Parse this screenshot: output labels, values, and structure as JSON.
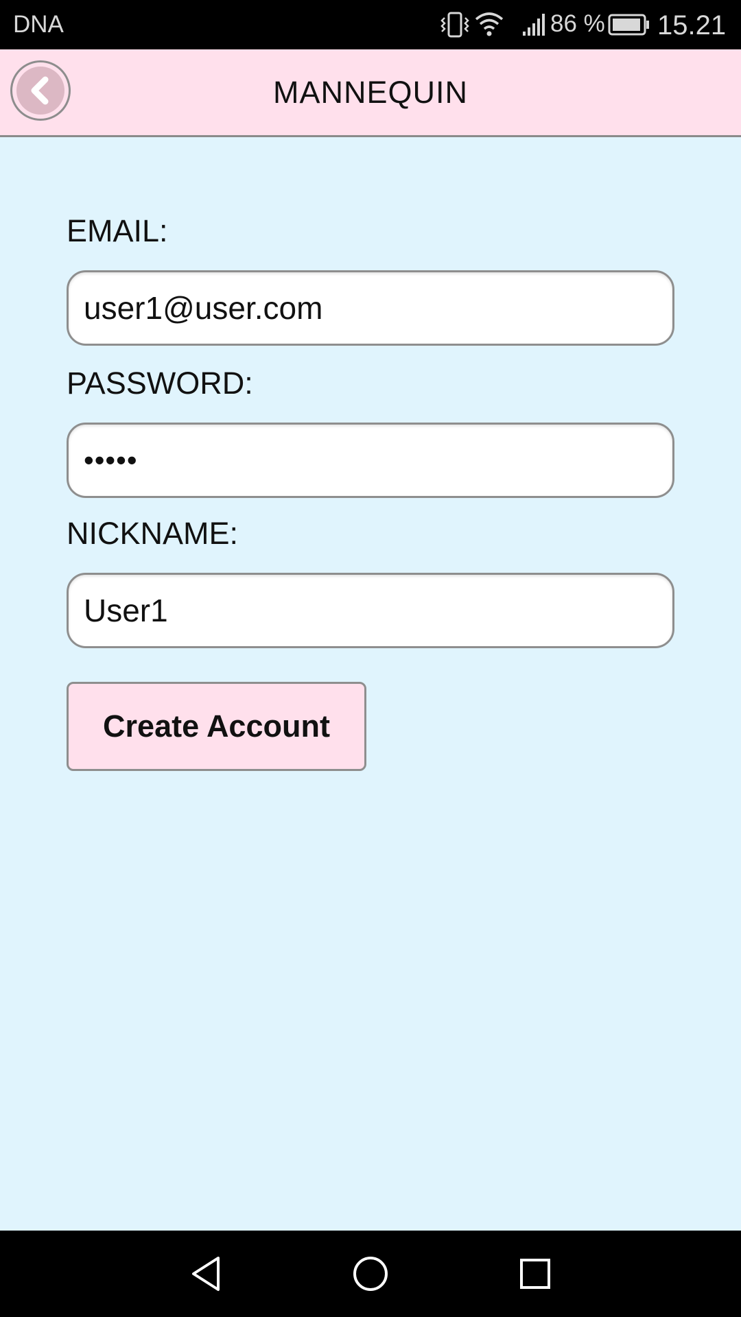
{
  "status_bar": {
    "carrier": "DNA",
    "battery_percent": "86 %",
    "time": "15.21",
    "icons": [
      "vibrate-icon",
      "wifi-icon",
      "signal-icon",
      "battery-icon"
    ]
  },
  "header": {
    "title": "MANNEQUIN",
    "back_icon": "chevron-left-icon",
    "background": "#ffe0ec"
  },
  "form": {
    "email_label": "EMAIL:",
    "email_value": "user1@user.com",
    "password_label": "PASSWORD:",
    "password_value": "•••••",
    "nickname_label": "NICKNAME:",
    "nickname_value": "User1",
    "create_button_label": "Create Account"
  },
  "nav_bar": {
    "icons": [
      "back-triangle-icon",
      "home-circle-icon",
      "recents-square-icon"
    ]
  },
  "colors": {
    "page_background": "#e0f4fd",
    "accent_pink": "#ffe0ec",
    "border_gray": "#8e8e8e"
  }
}
